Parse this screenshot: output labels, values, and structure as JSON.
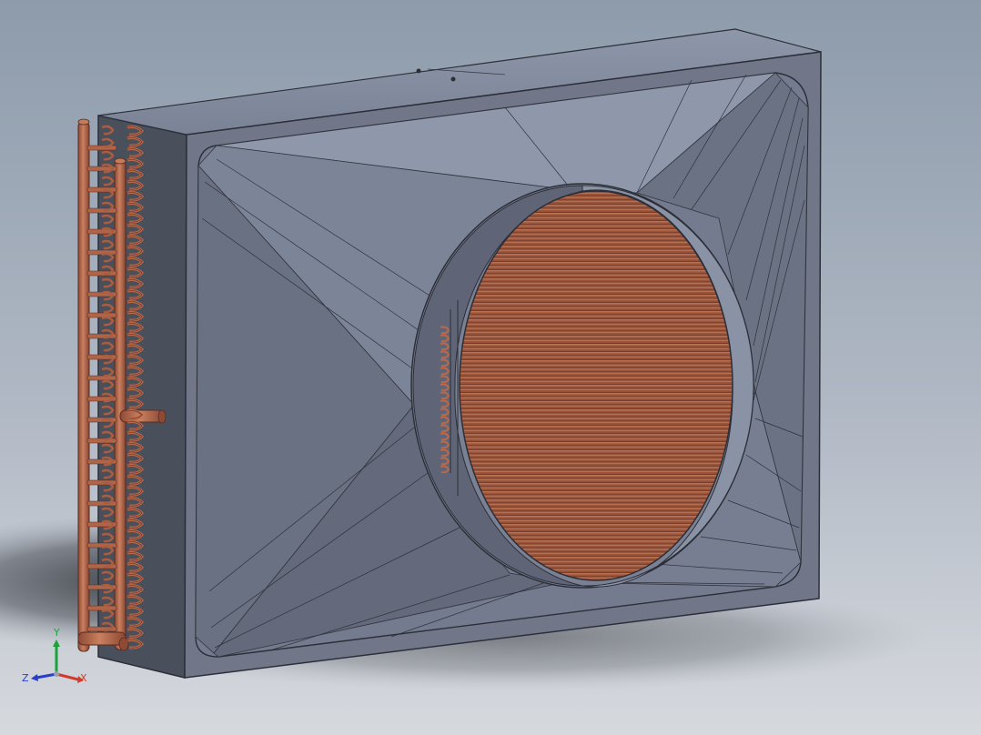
{
  "viewport": {
    "background_top": "#8d9bab",
    "background_bottom": "#d6d9de"
  },
  "model": {
    "housing_color": "#6f7586",
    "copper_color": "#b5664a"
  },
  "triad": {
    "x_label": "X",
    "y_label": "Y",
    "z_label": "Z",
    "x_color": "#d23a2a",
    "y_color": "#1aa33a",
    "z_color": "#2a3fc8"
  }
}
